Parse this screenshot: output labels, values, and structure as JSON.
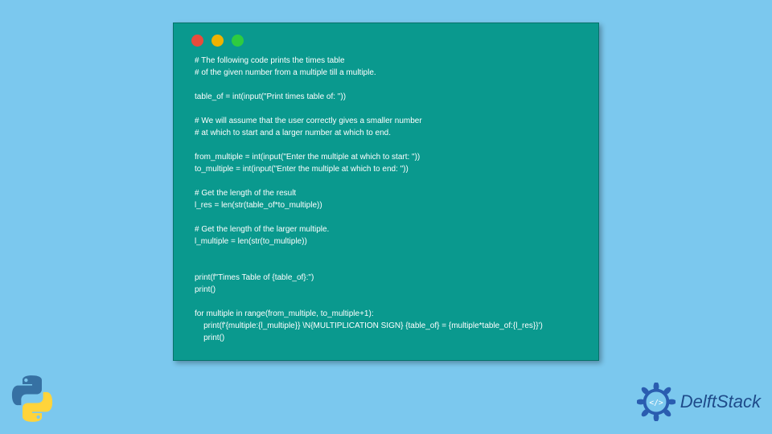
{
  "code": {
    "lines": [
      "# The following code prints the times table",
      "# of the given number from a multiple till a multiple.",
      "",
      "table_of = int(input(\"Print times table of: \"))",
      "",
      "# We will assume that the user correctly gives a smaller number",
      "# at which to start and a larger number at which to end.",
      "",
      "from_multiple = int(input(\"Enter the multiple at which to start: \"))",
      "to_multiple = int(input(\"Enter the multiple at which to end: \"))",
      "",
      "# Get the length of the result",
      "l_res = len(str(table_of*to_multiple))",
      "",
      "# Get the length of the larger multiple.",
      "l_multiple = len(str(to_multiple))",
      "",
      "",
      "print(f\"Times Table of {table_of}:\")",
      "print()",
      "",
      "for multiple in range(from_multiple, to_multiple+1):",
      "    print(f'{multiple:{l_multiple}} \\N{MULTIPLICATION SIGN} {table_of} = {multiple*table_of:{l_res}}')",
      "    print()"
    ]
  },
  "brand": {
    "name": "DelftStack"
  },
  "icons": {
    "python": "python-logo",
    "gear": "delftstack-gear"
  }
}
